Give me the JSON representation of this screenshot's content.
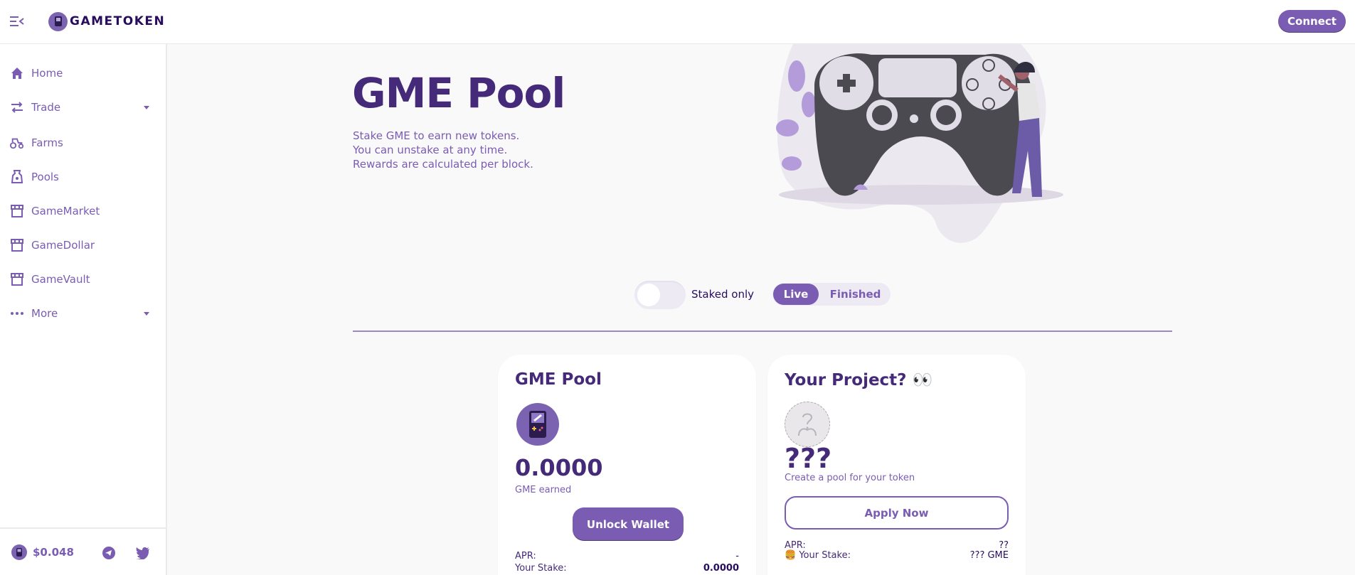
{
  "header": {
    "menu_icon": "menu-collapse-icon",
    "logo_text": "GAMETOKEN",
    "connect_label": "Connect"
  },
  "sidebar": {
    "items": [
      {
        "label": "Home",
        "icon": "home-icon"
      },
      {
        "label": "Trade",
        "icon": "trade-arrows-icon",
        "has_submenu": true
      },
      {
        "label": "Farms",
        "icon": "tractor-icon"
      },
      {
        "label": "Pools",
        "icon": "pool-bag-icon"
      },
      {
        "label": "GameMarket",
        "icon": "storefront-icon"
      },
      {
        "label": "GameDollar",
        "icon": "storefront-icon"
      },
      {
        "label": "GameVault",
        "icon": "storefront-icon"
      },
      {
        "label": "More",
        "icon": "more-dots-icon",
        "has_submenu": true
      }
    ],
    "footer": {
      "price": "$0.048",
      "social": [
        "telegram-icon",
        "twitter-icon"
      ]
    }
  },
  "hero": {
    "title": "GME Pool",
    "lines": [
      "Stake GME to earn new tokens.",
      "You can unstake at any time.",
      "Rewards are calculated per block."
    ],
    "illustration": "game-controller-illustration"
  },
  "filters": {
    "staked_only_label": "Staked only",
    "staked_only_on": false,
    "tabs": [
      "Live",
      "Finished"
    ],
    "active_tab": "Live"
  },
  "cards": [
    {
      "title": "GME Pool",
      "icon": "handheld-console-icon",
      "earned_value": "0.0000",
      "earned_label": "GME earned",
      "button": "Unlock Wallet",
      "apr_label": "APR:",
      "apr_value": "-",
      "stake_label": "Your Stake:",
      "stake_value": "0.0000"
    },
    {
      "title": "Your Project? 👀",
      "icon": "unknown-token-icon",
      "big_text": "???",
      "subtitle": "Create a pool for your token",
      "button": "Apply Now",
      "apr_label": "APR:",
      "apr_value": "??",
      "stake_label": "🍔 Your Stake:",
      "stake_value": "??? GME"
    }
  ],
  "colors": {
    "primary": "#7a5cb3",
    "heading": "#452a7a",
    "background": "#faf9fa"
  }
}
